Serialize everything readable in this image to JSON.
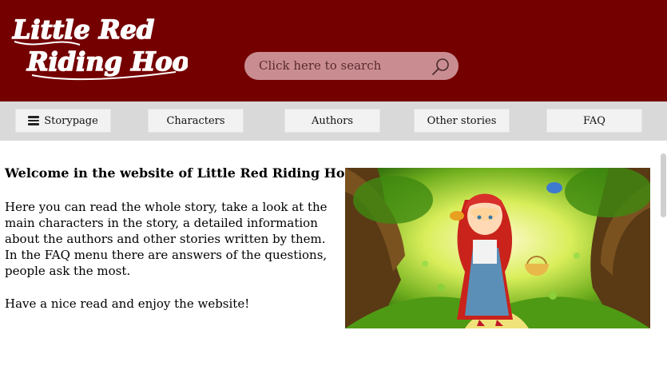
{
  "header": {
    "logo_line1": "Little Red",
    "logo_line2": "Riding Hood",
    "search_placeholder": "Click here to search",
    "search_icon": "search-icon"
  },
  "nav": {
    "items": [
      {
        "label": "Storypage",
        "icon": "menu-icon"
      },
      {
        "label": "Characters"
      },
      {
        "label": "Authors"
      },
      {
        "label": "Other stories"
      },
      {
        "label": "FAQ"
      }
    ]
  },
  "main": {
    "welcome": "Welcome in the website of Little Red Riding Hood!",
    "lines": [
      "Here you can read the whole story, take a look at the",
      "main characters in the story, a detailed information",
      "about the authors and other stories written by them.",
      "In the FAQ menu there are answers of the questions,",
      "people ask the most."
    ],
    "closing": "Have a nice read and enjoy the website!"
  },
  "colors": {
    "header_bg": "#740000",
    "nav_bg": "#d9d9d9",
    "search_bg": "#c98d91"
  }
}
